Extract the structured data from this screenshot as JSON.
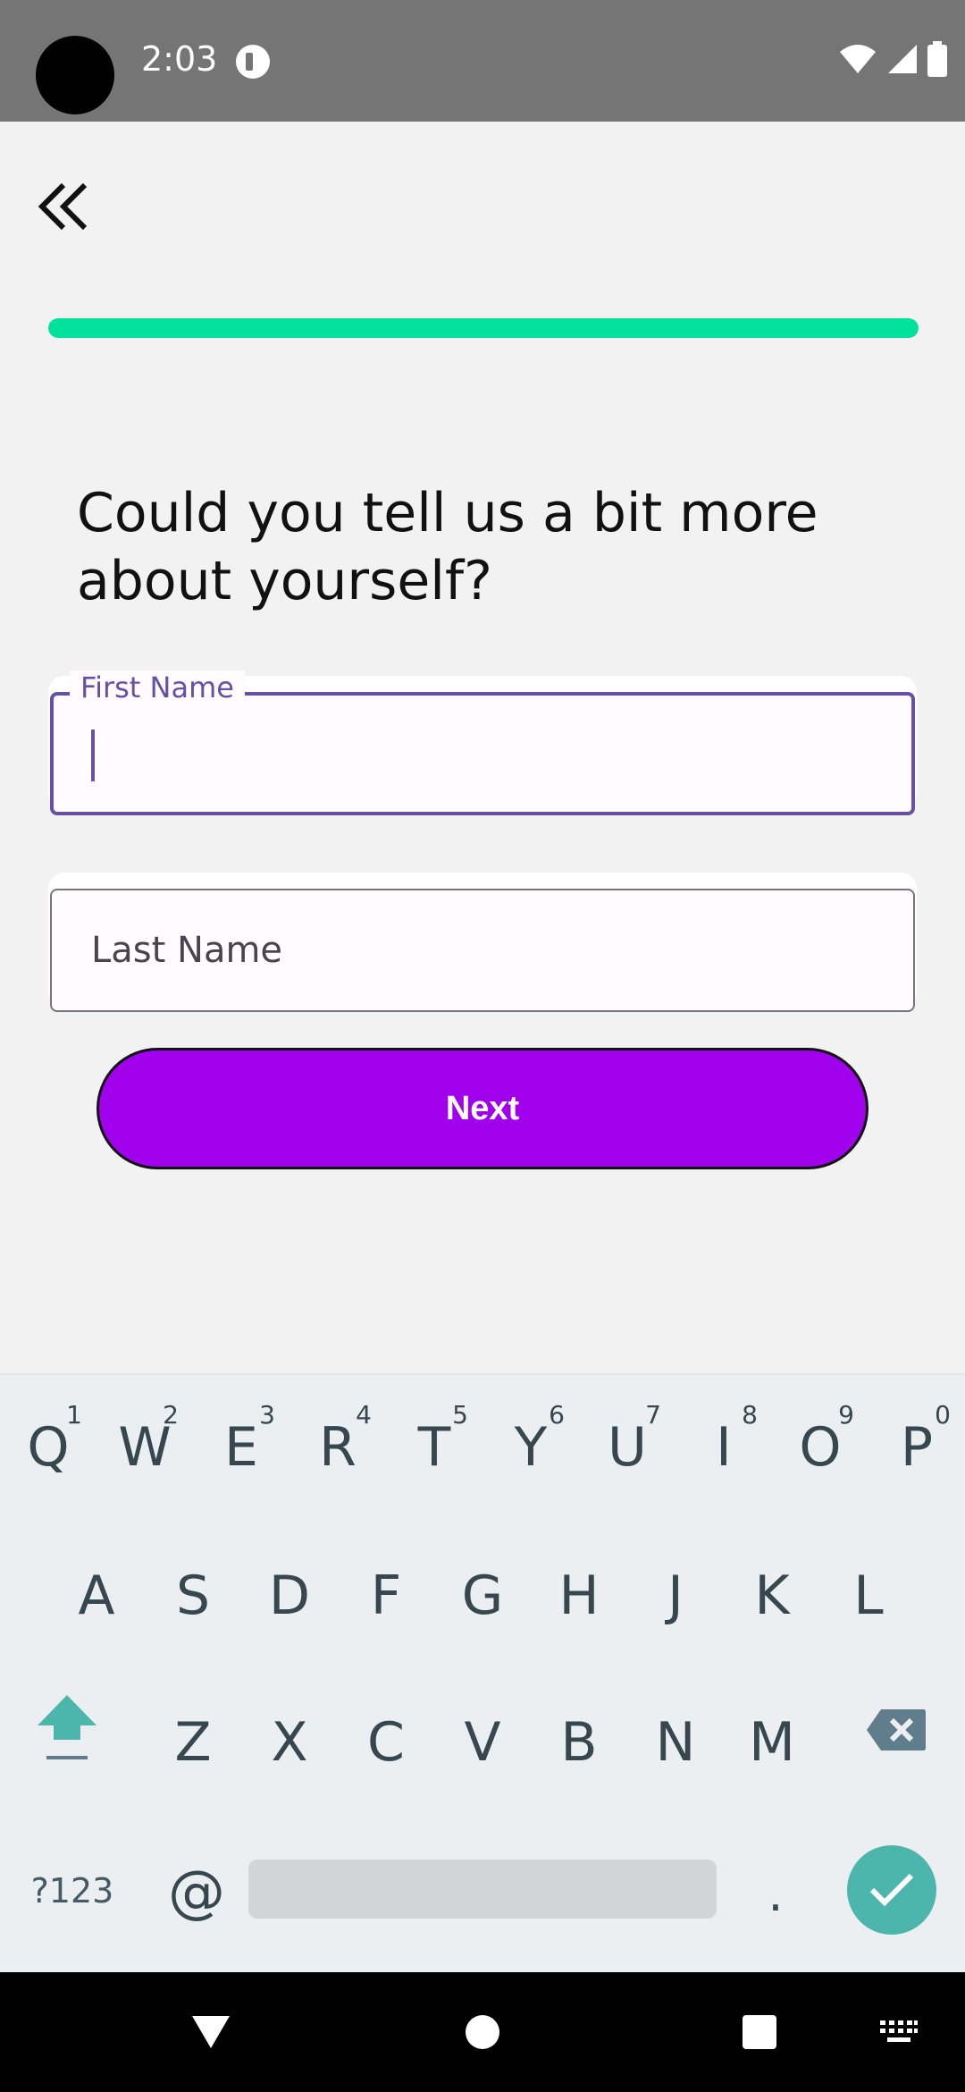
{
  "status_bar": {
    "time": "2:03",
    "icons": [
      "camera-cutout",
      "app-notification-icon",
      "wifi-icon",
      "signal-icon",
      "battery-icon"
    ]
  },
  "header": {
    "back_icon": "double-chevron-left-icon",
    "progress_fraction": 1.0,
    "progress_color": "#00e29c"
  },
  "form": {
    "question": "Could you tell us a bit more about yourself?",
    "first_name": {
      "label": "First Name",
      "value": ""
    },
    "last_name": {
      "placeholder": "Last Name",
      "value": ""
    },
    "next_label": "Next",
    "accent_color": "#6750a4",
    "button_color": "#a000ec"
  },
  "keyboard": {
    "row1": [
      {
        "key": "Q",
        "hint": "1"
      },
      {
        "key": "W",
        "hint": "2"
      },
      {
        "key": "E",
        "hint": "3"
      },
      {
        "key": "R",
        "hint": "4"
      },
      {
        "key": "T",
        "hint": "5"
      },
      {
        "key": "Y",
        "hint": "6"
      },
      {
        "key": "U",
        "hint": "7"
      },
      {
        "key": "I",
        "hint": "8"
      },
      {
        "key": "O",
        "hint": "9"
      },
      {
        "key": "P",
        "hint": "0"
      }
    ],
    "row2": [
      "A",
      "S",
      "D",
      "F",
      "G",
      "H",
      "J",
      "K",
      "L"
    ],
    "row3": [
      "Z",
      "X",
      "C",
      "V",
      "B",
      "N",
      "M"
    ],
    "symbols_label": "?123",
    "at_label": "@",
    "period_label": ".",
    "enter_icon": "check-icon",
    "enter_color": "#4db6ac"
  },
  "nav_bar": {
    "icons": [
      "back-triangle-icon",
      "home-circle-icon",
      "recents-square-icon",
      "keyboard-switch-icon"
    ]
  }
}
